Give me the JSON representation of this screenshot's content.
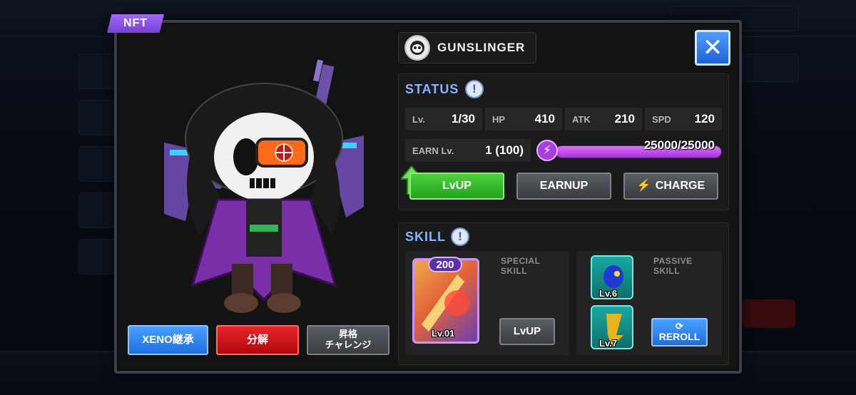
{
  "badge": "NFT",
  "character": {
    "class_name": "GUNSLINGER",
    "class_icon": "skull-mask-icon"
  },
  "status": {
    "title": "STATUS",
    "lv_label": "Lv.",
    "lv_value": "1/30",
    "hp_label": "HP",
    "hp_value": "410",
    "atk_label": "ATK",
    "atk_value": "210",
    "spd_label": "SPD",
    "spd_value": "120",
    "earn_label": "EARN Lv.",
    "earn_value": "1 (100)",
    "energy_text": "25000/25000",
    "energy_fraction": 1.0
  },
  "buttons": {
    "lvup": "LvUP",
    "earnup": "EARNUP",
    "charge": "CHARGE",
    "xeno": "XENO継承",
    "bunkai": "分解",
    "shokaku": "昇格\nチャレンジ",
    "skill_lvup": "LvUP",
    "reroll": "REROLL"
  },
  "skill": {
    "title": "SKILL",
    "special_label": "SPECIAL\nSKILL",
    "special_cost": "200",
    "special_level": "Lv.01",
    "passive_label": "PASSIVE\nSKILL",
    "passive_1_level": "Lv.6",
    "passive_2_level": "Lv.7"
  },
  "colors": {
    "accent_blue": "#8ab3ff",
    "lvup_green": "#25a11d",
    "danger_red": "#b3080c",
    "energy_purple": "#a233d6",
    "nft_purple": "#7b3fd8"
  }
}
